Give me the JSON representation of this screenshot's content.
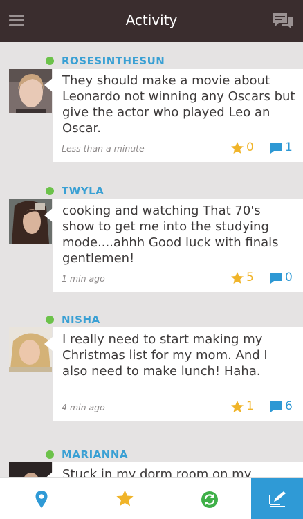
{
  "header": {
    "title": "Activity",
    "menu_icon": "menu-icon",
    "chat_icon": "chat-bubbles-icon"
  },
  "posts": [
    {
      "username": "ROSESINTHESUN",
      "text": "They should make a movie about Leonardo not winning any Oscars but give the actor who played Leo an Oscar.",
      "time": "Less than a minute",
      "stars": "0",
      "comments": "1"
    },
    {
      "username": "TWYLA",
      "text": "cooking and watching That 70's show to get me into the studying mode....ahhh Good luck with finals gentlemen!",
      "time": "1 min ago",
      "stars": "5",
      "comments": "0"
    },
    {
      "username": "NISHA",
      "text": "I really need to start making my Christmas list for my mom. And I also need to make lunch! Haha.",
      "time": "4 min ago",
      "stars": "1",
      "comments": "6"
    },
    {
      "username": "MARIANNA",
      "text": "Stuck in my dorm room on my birthday"
    }
  ],
  "tabbar": {
    "tabs": [
      {
        "icon": "location-pin-icon"
      },
      {
        "icon": "star-icon"
      },
      {
        "icon": "refresh-icon"
      },
      {
        "icon": "compose-icon",
        "active": true
      }
    ]
  },
  "colors": {
    "header_bg": "#3a2d2e",
    "accent_blue": "#2f9ad6",
    "star_yellow": "#f0b429",
    "online_green": "#6cc24a",
    "username_blue": "#3aa0d4"
  }
}
